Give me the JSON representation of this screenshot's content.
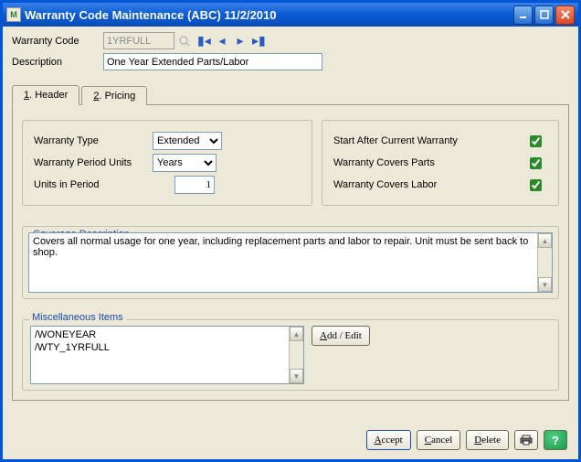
{
  "window": {
    "title": "Warranty Code Maintenance (ABC) 11/2/2010",
    "app_icon_label": "M"
  },
  "header_fields": {
    "warranty_code_label": "Warranty Code",
    "warranty_code_value": "1YRFULL",
    "description_label": "Description",
    "description_value": "One Year Extended Parts/Labor"
  },
  "tabs": {
    "header": {
      "mnemonic": "1",
      "label": ". Header"
    },
    "pricing": {
      "mnemonic": "2",
      "label": ". Pricing"
    }
  },
  "left_group": {
    "warranty_type_label": "Warranty Type",
    "warranty_type_value": "Extended",
    "warranty_period_units_label": "Warranty Period Units",
    "warranty_period_units_value": "Years",
    "units_in_period_label": "Units in Period",
    "units_in_period_value": "1"
  },
  "right_group": {
    "start_after_label": "Start After Current Warranty",
    "start_after_checked": true,
    "covers_parts_label": "Warranty Covers Parts",
    "covers_parts_checked": true,
    "covers_labor_label": "Warranty Covers Labor",
    "covers_labor_checked": true
  },
  "coverage": {
    "legend": "Coverage Description",
    "text": "Covers all normal usage for one year, including replacement parts and labor to repair.  Unit must be sent back to shop."
  },
  "misc": {
    "legend": "Miscellaneous Items",
    "items": [
      "/WONEYEAR",
      "/WTY_1YRFULL"
    ],
    "button_mnemonic": "A",
    "button_label": "dd / Edit"
  },
  "footer": {
    "accept": {
      "mn": "A",
      "rest": "ccept"
    },
    "cancel": {
      "mn": "C",
      "rest": "ancel"
    },
    "delete": {
      "mn": "D",
      "rest": "elete"
    },
    "help_glyph": "?"
  }
}
